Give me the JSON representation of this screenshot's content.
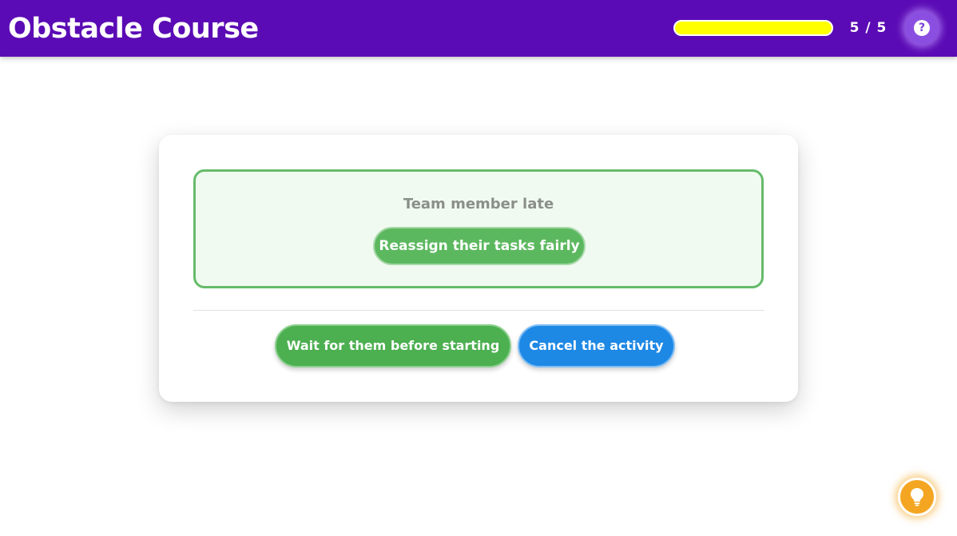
{
  "header": {
    "title": "Obstacle Course",
    "progress": {
      "current": 5,
      "total": 5,
      "fraction": 1.0,
      "label": "5 / 5",
      "fill_color": "#ffff00"
    },
    "help_icon": "question-circle-icon",
    "help_glyph": "?"
  },
  "scenario": {
    "label": "Team member late",
    "selected_answer": "Reassign their tasks fairly"
  },
  "options": [
    {
      "label": "Wait for them before starting",
      "color": "#4caf50"
    },
    {
      "label": "Cancel the activity",
      "color": "#1e88e5"
    }
  ],
  "hint_icon": "lightbulb-icon",
  "colors": {
    "header_bg": "#5b0bb5",
    "accent_green": "#66bb6a",
    "hint_orange": "#f4a623"
  }
}
